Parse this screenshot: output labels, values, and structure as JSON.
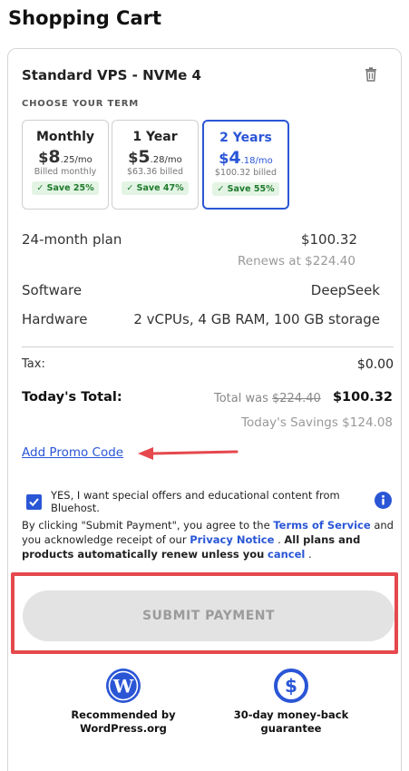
{
  "page_title": "Shopping Cart",
  "product": {
    "name": "Standard VPS - NVMe 4",
    "delete_icon": "trash-icon"
  },
  "term": {
    "heading": "CHOOSE YOUR TERM",
    "options": [
      {
        "label": "Monthly",
        "dollar": "$",
        "major": "8",
        "minor": ".25/mo",
        "billed": "Billed monthly",
        "save": "Save 25%",
        "selected": false
      },
      {
        "label": "1 Year",
        "dollar": "$",
        "major": "5",
        "minor": ".28/mo",
        "billed": "$63.36 billed",
        "save": "Save 47%",
        "selected": false
      },
      {
        "label": "2 Years",
        "dollar": "$",
        "major": "4",
        "minor": ".18/mo",
        "billed": "$100.32 billed",
        "save": "Save 55%",
        "selected": true
      }
    ]
  },
  "details": {
    "plan_label": "24-month plan",
    "plan_price": "$100.32",
    "renews": "Renews at $224.40",
    "software_label": "Software",
    "software_value": "DeepSeek",
    "hardware_label": "Hardware",
    "hardware_value": "2 vCPUs, 4 GB RAM, 100 GB storage"
  },
  "totals": {
    "tax_label": "Tax:",
    "tax_value": "$0.00",
    "total_label": "Today's Total:",
    "was_prefix": "Total was",
    "was_value": "$224.40",
    "total_value": "$100.32",
    "savings": "Today's Savings $124.08"
  },
  "promo_link": "Add Promo Code",
  "optin": {
    "checked": true,
    "text": "YES, I want special offers and educational content from Bluehost."
  },
  "legal": {
    "part1": "By clicking \"Submit Payment\", you agree to the",
    "terms_link": "Terms of Service",
    "part2": "and you acknowledge receipt of our",
    "privacy_link": "Privacy Notice",
    "part3": ".",
    "bold_text": "All plans and products automatically renew unless you",
    "cancel_link": "cancel",
    "part4": "."
  },
  "submit_label": "SUBMIT PAYMENT",
  "badges": [
    {
      "icon": "wordpress-logo-icon",
      "line1": "Recommended by",
      "line2": "WordPress.org"
    },
    {
      "icon": "dollar-guarantee-icon",
      "line1": "30-day money-back",
      "line2": "guarantee"
    }
  ],
  "colors": {
    "accent": "#2a56d6",
    "save_green": "#1d7a2b",
    "highlight_red": "#e5484d",
    "button_disabled": "#e3e3e3"
  }
}
